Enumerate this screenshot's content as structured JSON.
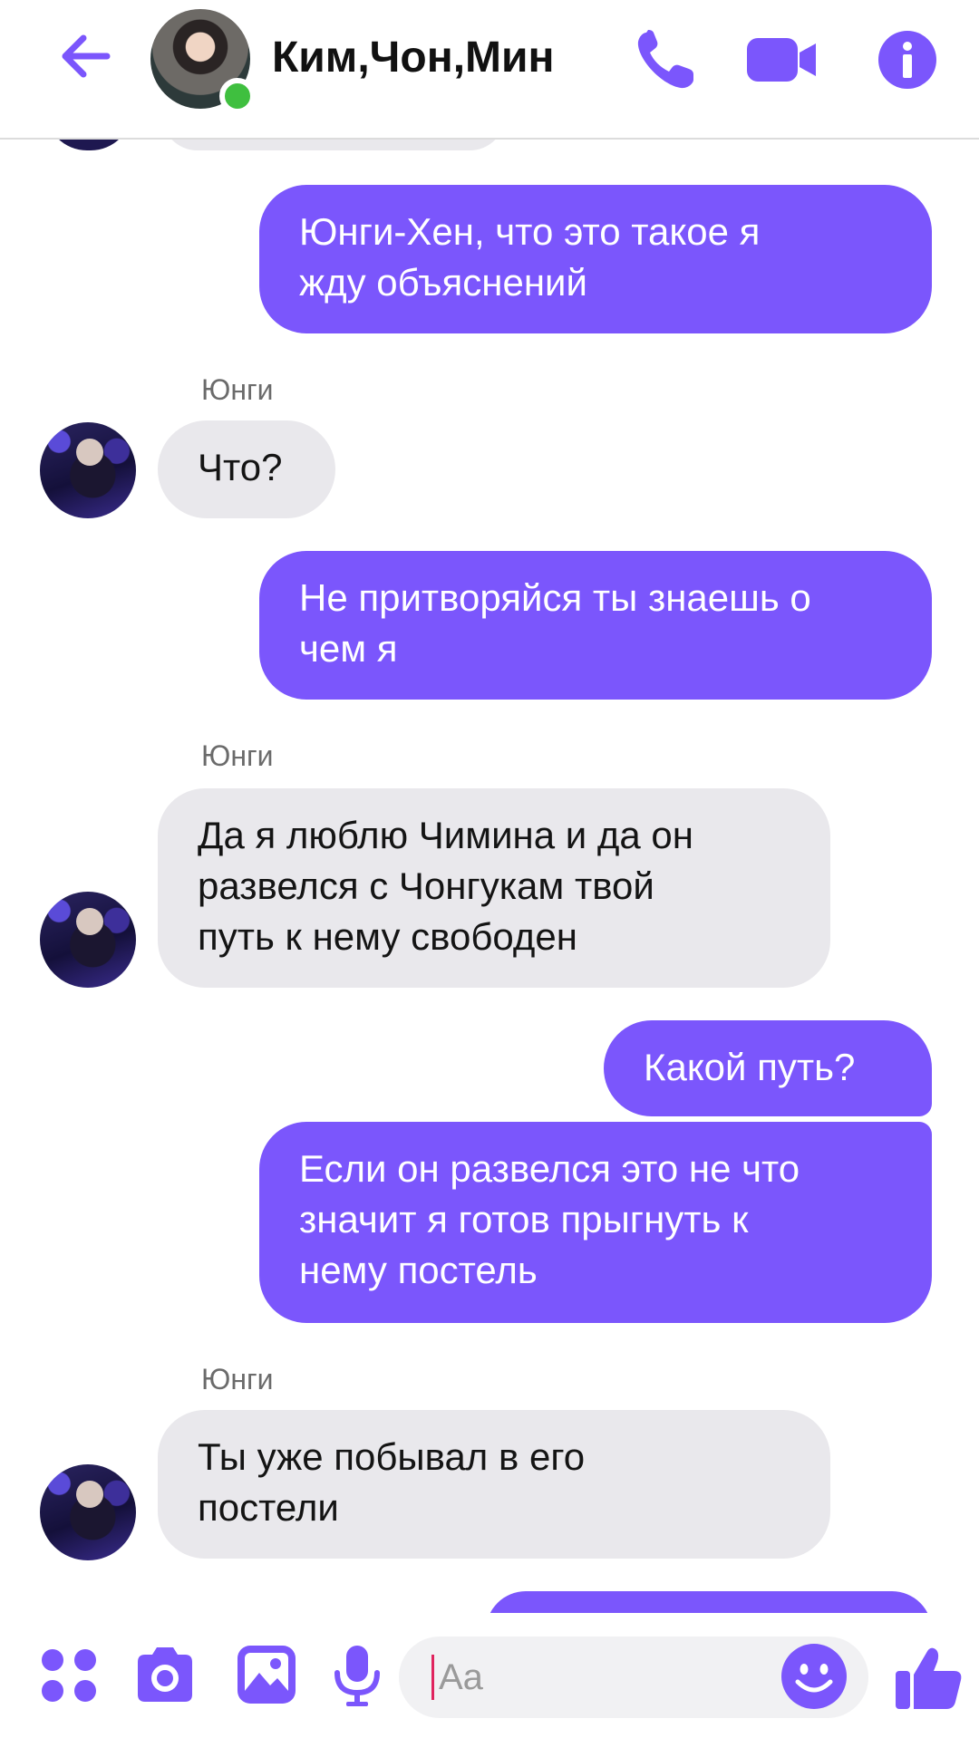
{
  "header": {
    "title": "Ким,Чон,Мин",
    "icons": [
      "back-arrow-icon",
      "phone-icon",
      "video-camera-icon",
      "info-icon"
    ]
  },
  "messages": [
    {
      "id": "m1",
      "direction": "outgoing",
      "text": "Юнги-Хен, что это такое я\nжду объяснений"
    },
    {
      "id": "m2",
      "direction": "incoming",
      "sender": "Юнги",
      "text": "Что?"
    },
    {
      "id": "m3",
      "direction": "outgoing",
      "text": "Не притворяйся ты знаешь о\nчем я"
    },
    {
      "id": "m4",
      "direction": "incoming",
      "sender": "Юнги",
      "text": " Да я люблю Чимина и да он\nразвелся с Чонгукам твой\nпуть к нему свободен"
    },
    {
      "id": "m5",
      "direction": "outgoing",
      "text": "Какой путь?"
    },
    {
      "id": "m6",
      "direction": "outgoing",
      "text": "Если он развелся это не что\nзначит я готов прыгнуть к\nнему постель"
    },
    {
      "id": "m7",
      "direction": "incoming",
      "sender": "Юнги",
      "text": "Ты уже побывал в его\nпостели"
    }
  ],
  "composer": {
    "placeholder": "Aa",
    "icons": [
      "apps-grid-icon",
      "camera-icon",
      "gallery-icon",
      "microphone-icon",
      "emoji-icon",
      "thumbs-up-icon"
    ]
  },
  "colors": {
    "accent": "#7b56fc",
    "outgoing_bubble": "#7b56fc",
    "incoming_bubble": "#e9e8ec",
    "online": "#3fbf3f"
  }
}
